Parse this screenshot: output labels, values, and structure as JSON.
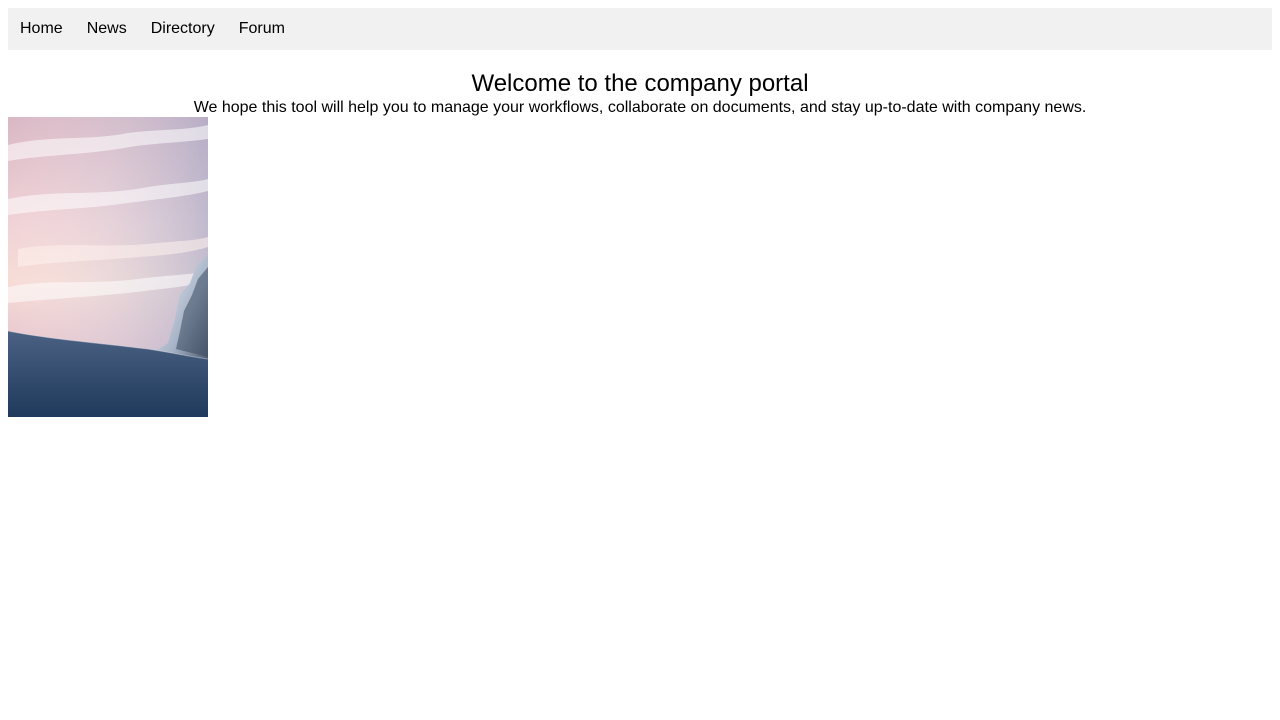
{
  "nav": {
    "items": [
      {
        "label": "Home"
      },
      {
        "label": "News"
      },
      {
        "label": "Directory"
      },
      {
        "label": "Forum"
      }
    ]
  },
  "main": {
    "title": "Welcome to the company portal",
    "intro": "We hope this tool will help you to manage your workflows, collaborate on documents, and stay up-to-date with company news."
  },
  "image": {
    "subject": "snowy mountain peak at sunset"
  },
  "colors": {
    "nav_bg": "#f1f1f1",
    "text": "#000000",
    "page_bg": "#ffffff"
  }
}
